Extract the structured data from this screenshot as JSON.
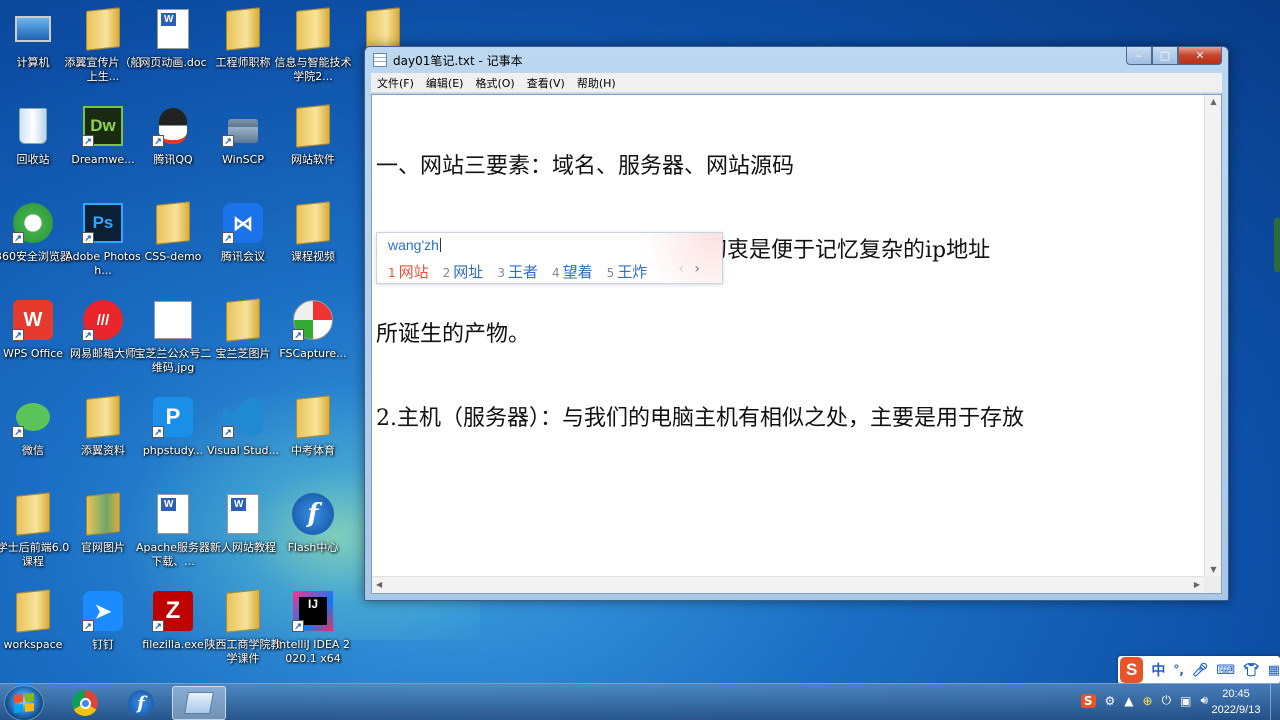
{
  "desktop": {
    "icons": [
      {
        "label": "计算机"
      },
      {
        "label": "添翼宣传片（船上生..."
      },
      {
        "label": "网页动画.doc"
      },
      {
        "label": "工程师职称"
      },
      {
        "label": "信息与智能技术学院2..."
      },
      {
        "label": ""
      },
      {
        "label": "回收站"
      },
      {
        "label": "Dreamwe..."
      },
      {
        "label": "腾讯QQ"
      },
      {
        "label": "WinSCP"
      },
      {
        "label": "网站软件"
      },
      {
        "label": "360安全浏览器"
      },
      {
        "label": "Adobe Photosh..."
      },
      {
        "label": "CSS-demo"
      },
      {
        "label": "腾讯会议"
      },
      {
        "label": "课程视频"
      },
      {
        "label": "WPS Office"
      },
      {
        "label": "网易邮箱大师"
      },
      {
        "label": "宝芝兰公众号二维码.jpg"
      },
      {
        "label": "宝兰芝图片"
      },
      {
        "label": "FSCapture..."
      },
      {
        "label": "微信"
      },
      {
        "label": "添翼资料"
      },
      {
        "label": "phpstudy..."
      },
      {
        "label": "Visual Stud..."
      },
      {
        "label": "中考体育"
      },
      {
        "label": "学士后前端6.0课程"
      },
      {
        "label": "官网图片"
      },
      {
        "label": "Apache服务器下载、..."
      },
      {
        "label": "新人网站教程"
      },
      {
        "label": "Flash中心"
      },
      {
        "label": "workspace"
      },
      {
        "label": "钉钉"
      },
      {
        "label": "filezilla.exe"
      },
      {
        "label": "陕西工商学院教学课件"
      },
      {
        "label": "IntelliJ IDEA 2020.1 x64"
      }
    ]
  },
  "notepad": {
    "title": "day01笔记.txt - 记事本",
    "menu": [
      "文件(F)",
      "编辑(E)",
      "格式(O)",
      "查看(V)",
      "帮助(H)"
    ],
    "lines": [
      "一、网站三要素：域名、服务器、网站源码",
      "1.域名：通俗来说是网站地址，其初衷是便于记忆复杂的ip地址",
      "所诞生的产物。",
      "2.主机（服务器）：与我们的电脑主机有相似之处，主要是用于存放"
    ],
    "window_buttons": {
      "minimize": "–",
      "maximize": "□",
      "close": "✕"
    }
  },
  "ime_popup": {
    "pinyin": "wang'zh",
    "candidates": [
      {
        "num": "1",
        "text": "网站"
      },
      {
        "num": "2",
        "text": "网址"
      },
      {
        "num": "3",
        "text": "王者"
      },
      {
        "num": "4",
        "text": "望着"
      },
      {
        "num": "5",
        "text": "王炸"
      }
    ],
    "prev": "‹",
    "next": "›"
  },
  "ime_bar": {
    "logo": "S",
    "mode": "中"
  },
  "taskbar": {
    "time": "20:45",
    "date": "2022/9/13"
  },
  "colors": {
    "accent": "#2e6fc4",
    "active_candidate": "#e8503a",
    "sogou": "#e8542a"
  }
}
